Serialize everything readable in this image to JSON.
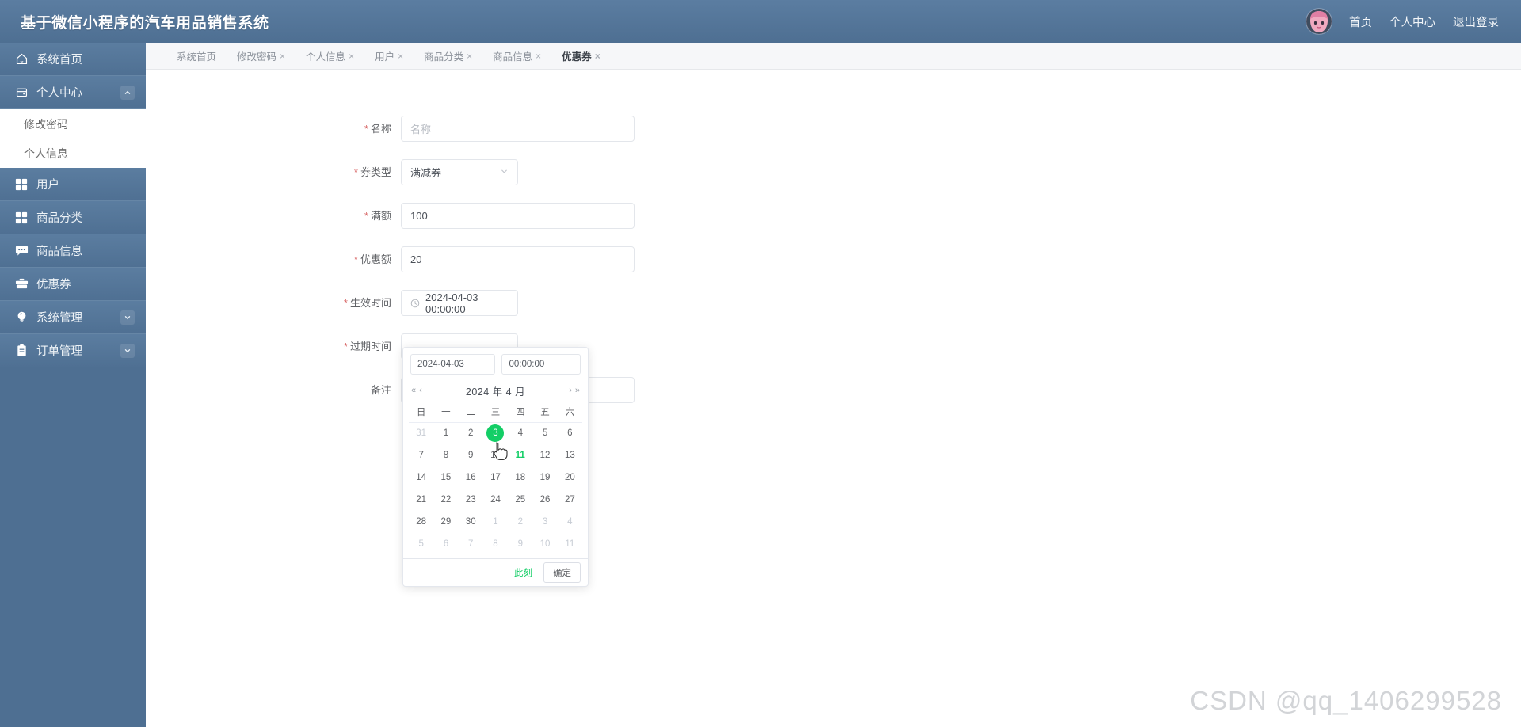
{
  "header": {
    "title": "基于微信小程序的汽车用品销售系统",
    "avatar_name": "user-avatar",
    "links": [
      {
        "label": "首页",
        "name": "home"
      },
      {
        "label": "个人中心",
        "name": "user-center"
      },
      {
        "label": "退出登录",
        "name": "logout"
      }
    ]
  },
  "sidebar": {
    "items": [
      {
        "label": "系统首页",
        "icon": "home-icon",
        "arrow": "",
        "active": false
      },
      {
        "label": "个人中心",
        "icon": "card-icon",
        "arrow": "up",
        "active": true
      },
      {
        "label": "用户",
        "icon": "grid-icon",
        "arrow": "",
        "active": false
      },
      {
        "label": "商品分类",
        "icon": "grid-icon",
        "arrow": "",
        "active": false
      },
      {
        "label": "商品信息",
        "icon": "comment-icon",
        "arrow": "",
        "active": false
      },
      {
        "label": "优惠券",
        "icon": "briefcase-icon",
        "arrow": "",
        "active": true
      },
      {
        "label": "系统管理",
        "icon": "bulb-icon",
        "arrow": "down",
        "active": false
      },
      {
        "label": "订单管理",
        "icon": "clipboard-icon",
        "arrow": "down",
        "active": false
      }
    ],
    "submenu": [
      {
        "label": "修改密码"
      },
      {
        "label": "个人信息"
      }
    ]
  },
  "tabs": [
    {
      "label": "系统首页",
      "closable": false,
      "active": false
    },
    {
      "label": "修改密码",
      "closable": true,
      "active": false
    },
    {
      "label": "个人信息",
      "closable": true,
      "active": false
    },
    {
      "label": "用户",
      "closable": true,
      "active": false
    },
    {
      "label": "商品分类",
      "closable": true,
      "active": false
    },
    {
      "label": "商品信息",
      "closable": true,
      "active": false
    },
    {
      "label": "优惠券",
      "closable": true,
      "active": true
    }
  ],
  "tab_close_glyph": "×",
  "form": {
    "name": {
      "label": "名称",
      "required": true,
      "placeholder": "名称",
      "value": ""
    },
    "coupon_type": {
      "label": "券类型",
      "required": true,
      "value": "满减券",
      "chevron": "⌄"
    },
    "full_amount": {
      "label": "满额",
      "required": true,
      "value": "100"
    },
    "discount_amount": {
      "label": "优惠额",
      "required": true,
      "value": "20"
    },
    "effective_time": {
      "label": "生效时间",
      "required": true,
      "value": "2024-04-03 00:00:00",
      "icon": "clock-icon"
    },
    "expire_time": {
      "label": "过期时间",
      "required": true,
      "value": ""
    },
    "remark": {
      "label": "备注",
      "required": false,
      "value": ""
    }
  },
  "datepicker": {
    "date_input": "2024-04-03",
    "time_input": "00:00:00",
    "nav_prev_year": "«",
    "nav_prev_month": "‹",
    "nav_next_month": "›",
    "nav_next_year": "»",
    "title": "2024 年 4 月",
    "weekdays": [
      "日",
      "一",
      "二",
      "三",
      "四",
      "五",
      "六"
    ],
    "weeks": [
      [
        {
          "d": "31",
          "state": "muted"
        },
        {
          "d": "1",
          "state": "normal"
        },
        {
          "d": "2",
          "state": "normal"
        },
        {
          "d": "3",
          "state": "selected"
        },
        {
          "d": "4",
          "state": "normal"
        },
        {
          "d": "5",
          "state": "normal"
        },
        {
          "d": "6",
          "state": "normal"
        }
      ],
      [
        {
          "d": "7",
          "state": "normal"
        },
        {
          "d": "8",
          "state": "normal"
        },
        {
          "d": "9",
          "state": "normal"
        },
        {
          "d": "10",
          "state": "normal"
        },
        {
          "d": "11",
          "state": "today"
        },
        {
          "d": "12",
          "state": "normal"
        },
        {
          "d": "13",
          "state": "normal"
        }
      ],
      [
        {
          "d": "14",
          "state": "normal"
        },
        {
          "d": "15",
          "state": "normal"
        },
        {
          "d": "16",
          "state": "normal"
        },
        {
          "d": "17",
          "state": "normal"
        },
        {
          "d": "18",
          "state": "normal"
        },
        {
          "d": "19",
          "state": "normal"
        },
        {
          "d": "20",
          "state": "normal"
        }
      ],
      [
        {
          "d": "21",
          "state": "normal"
        },
        {
          "d": "22",
          "state": "normal"
        },
        {
          "d": "23",
          "state": "normal"
        },
        {
          "d": "24",
          "state": "normal"
        },
        {
          "d": "25",
          "state": "normal"
        },
        {
          "d": "26",
          "state": "normal"
        },
        {
          "d": "27",
          "state": "normal"
        }
      ],
      [
        {
          "d": "28",
          "state": "normal"
        },
        {
          "d": "29",
          "state": "normal"
        },
        {
          "d": "30",
          "state": "normal"
        },
        {
          "d": "1",
          "state": "muted"
        },
        {
          "d": "2",
          "state": "muted"
        },
        {
          "d": "3",
          "state": "muted"
        },
        {
          "d": "4",
          "state": "muted"
        }
      ],
      [
        {
          "d": "5",
          "state": "muted"
        },
        {
          "d": "6",
          "state": "muted"
        },
        {
          "d": "7",
          "state": "muted"
        },
        {
          "d": "8",
          "state": "muted"
        },
        {
          "d": "9",
          "state": "muted"
        },
        {
          "d": "10",
          "state": "muted"
        },
        {
          "d": "11",
          "state": "muted"
        }
      ]
    ],
    "now_label": "此刻",
    "confirm_label": "确定"
  },
  "watermark": "CSDN @qq_1406299528",
  "colors": {
    "header_bg": "#4e6f92",
    "sidebar_bg": "#4e6f92",
    "accent_green": "#13ce66",
    "required_red": "#d96a6a"
  }
}
